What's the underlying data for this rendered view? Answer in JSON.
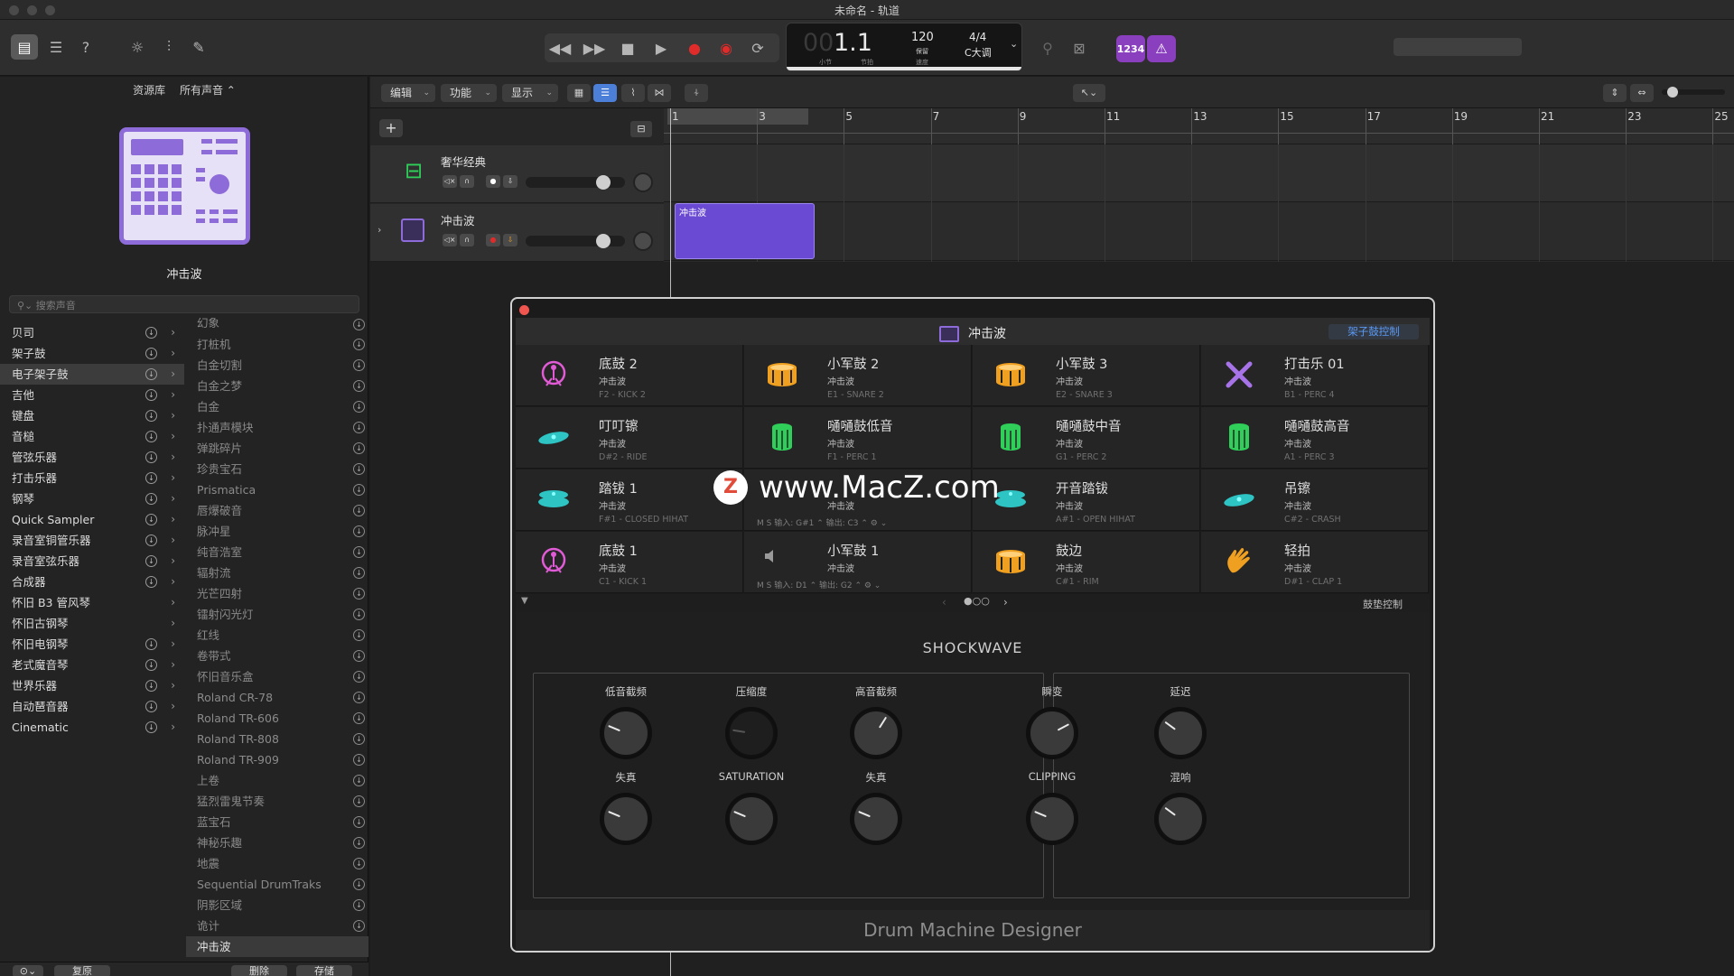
{
  "window": {
    "title": "未命名 - 轨道"
  },
  "toolbar": {
    "lcd": {
      "position": "1.1",
      "position_prefix": "00",
      "bar_label": "小节",
      "beat_label": "节拍",
      "tempo": "120",
      "tempo_sub": "保留",
      "tempo_label": "速度",
      "signature": "4/4",
      "key": "C大调"
    },
    "count_in_label": "1234"
  },
  "library": {
    "header_left": "资源库",
    "header_right": "所有声音 ⌃",
    "selected_patch": "冲击波",
    "search_placeholder": "搜索声音",
    "categories": [
      {
        "label": "贝司"
      },
      {
        "label": "架子鼓"
      },
      {
        "label": "电子架子鼓"
      },
      {
        "label": "吉他"
      },
      {
        "label": "键盘"
      },
      {
        "label": "音槌"
      },
      {
        "label": "管弦乐器"
      },
      {
        "label": "打击乐器"
      },
      {
        "label": "钢琴"
      },
      {
        "label": "Quick Sampler"
      },
      {
        "label": "录音室铜管乐器"
      },
      {
        "label": "录音室弦乐器"
      },
      {
        "label": "合成器"
      },
      {
        "label": "怀旧 B3 管风琴"
      },
      {
        "label": "怀旧古钢琴"
      },
      {
        "label": "怀旧电钢琴"
      },
      {
        "label": "老式魔音琴"
      },
      {
        "label": "世界乐器"
      },
      {
        "label": "自动琶音器"
      },
      {
        "label": "Cinematic"
      }
    ],
    "patches": [
      {
        "label": "幻象"
      },
      {
        "label": "打桩机"
      },
      {
        "label": "白金切割"
      },
      {
        "label": "白金之梦"
      },
      {
        "label": "白金"
      },
      {
        "label": "扑通声模块"
      },
      {
        "label": "弹跳碎片"
      },
      {
        "label": "珍贵宝石"
      },
      {
        "label": "Prismatica"
      },
      {
        "label": "唇爆破音"
      },
      {
        "label": "脉冲星"
      },
      {
        "label": "纯音浩室"
      },
      {
        "label": "辐射流"
      },
      {
        "label": "光芒四射"
      },
      {
        "label": "镭射闪光灯"
      },
      {
        "label": "红线"
      },
      {
        "label": "卷带式"
      },
      {
        "label": "怀旧音乐盒"
      },
      {
        "label": "Roland CR-78"
      },
      {
        "label": "Roland TR-606"
      },
      {
        "label": "Roland TR-808"
      },
      {
        "label": "Roland TR-909"
      },
      {
        "label": "上卷"
      },
      {
        "label": "猛烈雷鬼节奏"
      },
      {
        "label": "蓝宝石"
      },
      {
        "label": "神秘乐趣"
      },
      {
        "label": "地震"
      },
      {
        "label": "Sequential DrumTraks"
      },
      {
        "label": "阴影区域"
      },
      {
        "label": "诡计"
      },
      {
        "label": "冲击波"
      }
    ],
    "footer": {
      "restore": "复原",
      "delete": "删除",
      "save": "存储"
    }
  },
  "tracks_toolbar": {
    "edit": "编辑",
    "functions": "功能",
    "view": "显示"
  },
  "tracks": [
    {
      "name": "奢华经典"
    },
    {
      "name": "冲击波"
    }
  ],
  "ruler": [
    "1",
    "3",
    "5",
    "7",
    "9",
    "11",
    "13",
    "15",
    "17",
    "19",
    "21",
    "23",
    "25"
  ],
  "region": {
    "name": "冲击波"
  },
  "dmd": {
    "title": "冲击波",
    "kit_control": "架子鼓控制",
    "pad_control": "鼓垫控制",
    "pads": [
      {
        "name": "底鼓 2",
        "kit": "冲击波",
        "note": "F2 - KICK 2",
        "icon": "kick-icon",
        "color": "#e05bd5"
      },
      {
        "name": "小军鼓 2",
        "kit": "冲击波",
        "note": "E1 - SNARE 2",
        "icon": "snare-icon",
        "color": "#f0a020"
      },
      {
        "name": "小军鼓 3",
        "kit": "冲击波",
        "note": "E2 - SNARE 3",
        "icon": "snare-icon",
        "color": "#f0a020"
      },
      {
        "name": "打击乐 01",
        "kit": "冲击波",
        "note": "B1 - PERC 4",
        "icon": "sticks-icon",
        "color": "#a673e8"
      },
      {
        "name": "叮叮镲",
        "kit": "冲击波",
        "note": "D#2 - RIDE",
        "icon": "cymbal-icon",
        "color": "#2ec4c4"
      },
      {
        "name": "嗵嗵鼓低音",
        "kit": "冲击波",
        "note": "F1 - PERC 1",
        "icon": "tom-icon",
        "color": "#2fcf5a"
      },
      {
        "name": "嗵嗵鼓中音",
        "kit": "冲击波",
        "note": "G1 - PERC 2",
        "icon": "tom-icon",
        "color": "#2fcf5a"
      },
      {
        "name": "嗵嗵鼓高音",
        "kit": "冲击波",
        "note": "A1 - PERC 3",
        "icon": "tom-icon",
        "color": "#2fcf5a"
      },
      {
        "name": "踏钹 1",
        "kit": "冲击波",
        "note": "F#1 - CLOSED HIHAT",
        "icon": "hihat-icon",
        "color": "#2ec4c4"
      },
      {
        "name": "",
        "kit": "冲击波",
        "note": "",
        "icon": "empty",
        "color": "#2ec4c4",
        "extra": "M    S        输入: G#1 ⌃        输出: C3 ⌃           ⚙ ⌄"
      },
      {
        "name": "开音踏钹",
        "kit": "冲击波",
        "note": "A#1 - OPEN HIHAT",
        "icon": "hihat-icon",
        "color": "#2ec4c4"
      },
      {
        "name": "吊镲",
        "kit": "冲击波",
        "note": "C#2 - CRASH",
        "icon": "cymbal-icon",
        "color": "#2ec4c4"
      },
      {
        "name": "底鼓 1",
        "kit": "冲击波",
        "note": "C1 - KICK 1",
        "icon": "kick-icon",
        "color": "#e05bd5"
      },
      {
        "name": "小军鼓 1",
        "kit": "冲击波",
        "note": "",
        "icon": "speaker-icon",
        "color": "#9a9a9a",
        "extra": "M    S        输入: D1 ⌃          输出: G2 ⌃           ⚙ ⌄"
      },
      {
        "name": "鼓边",
        "kit": "冲击波",
        "note": "C#1 - RIM",
        "icon": "snare-icon",
        "color": "#f0a020"
      },
      {
        "name": "轻拍",
        "kit": "冲击波",
        "note": "D#1 - CLAP 1",
        "icon": "clap-icon",
        "color": "#f0a020"
      }
    ],
    "synth": {
      "title": "SHOCKWAVE",
      "knobs": [
        {
          "label": "低音截频",
          "value": 0.25
        },
        {
          "label": "压缩度",
          "value": 0.2
        },
        {
          "label": "高音截频",
          "value": 0.62
        },
        {
          "label": "失真",
          "value": 0.25
        },
        {
          "label": "SATURATION",
          "value": 0.25
        },
        {
          "label": "失真",
          "value": 0.25
        },
        {
          "label": "瞬变",
          "value": 0.73
        },
        {
          "label": "延迟",
          "value": 0.3
        },
        {
          "label": "CLIPPING",
          "value": 0.25
        },
        {
          "label": "混响",
          "value": 0.3
        }
      ]
    },
    "brand": "Drum Machine Designer"
  },
  "watermark": {
    "text": "www.MacZ.com",
    "logo": "Z"
  }
}
